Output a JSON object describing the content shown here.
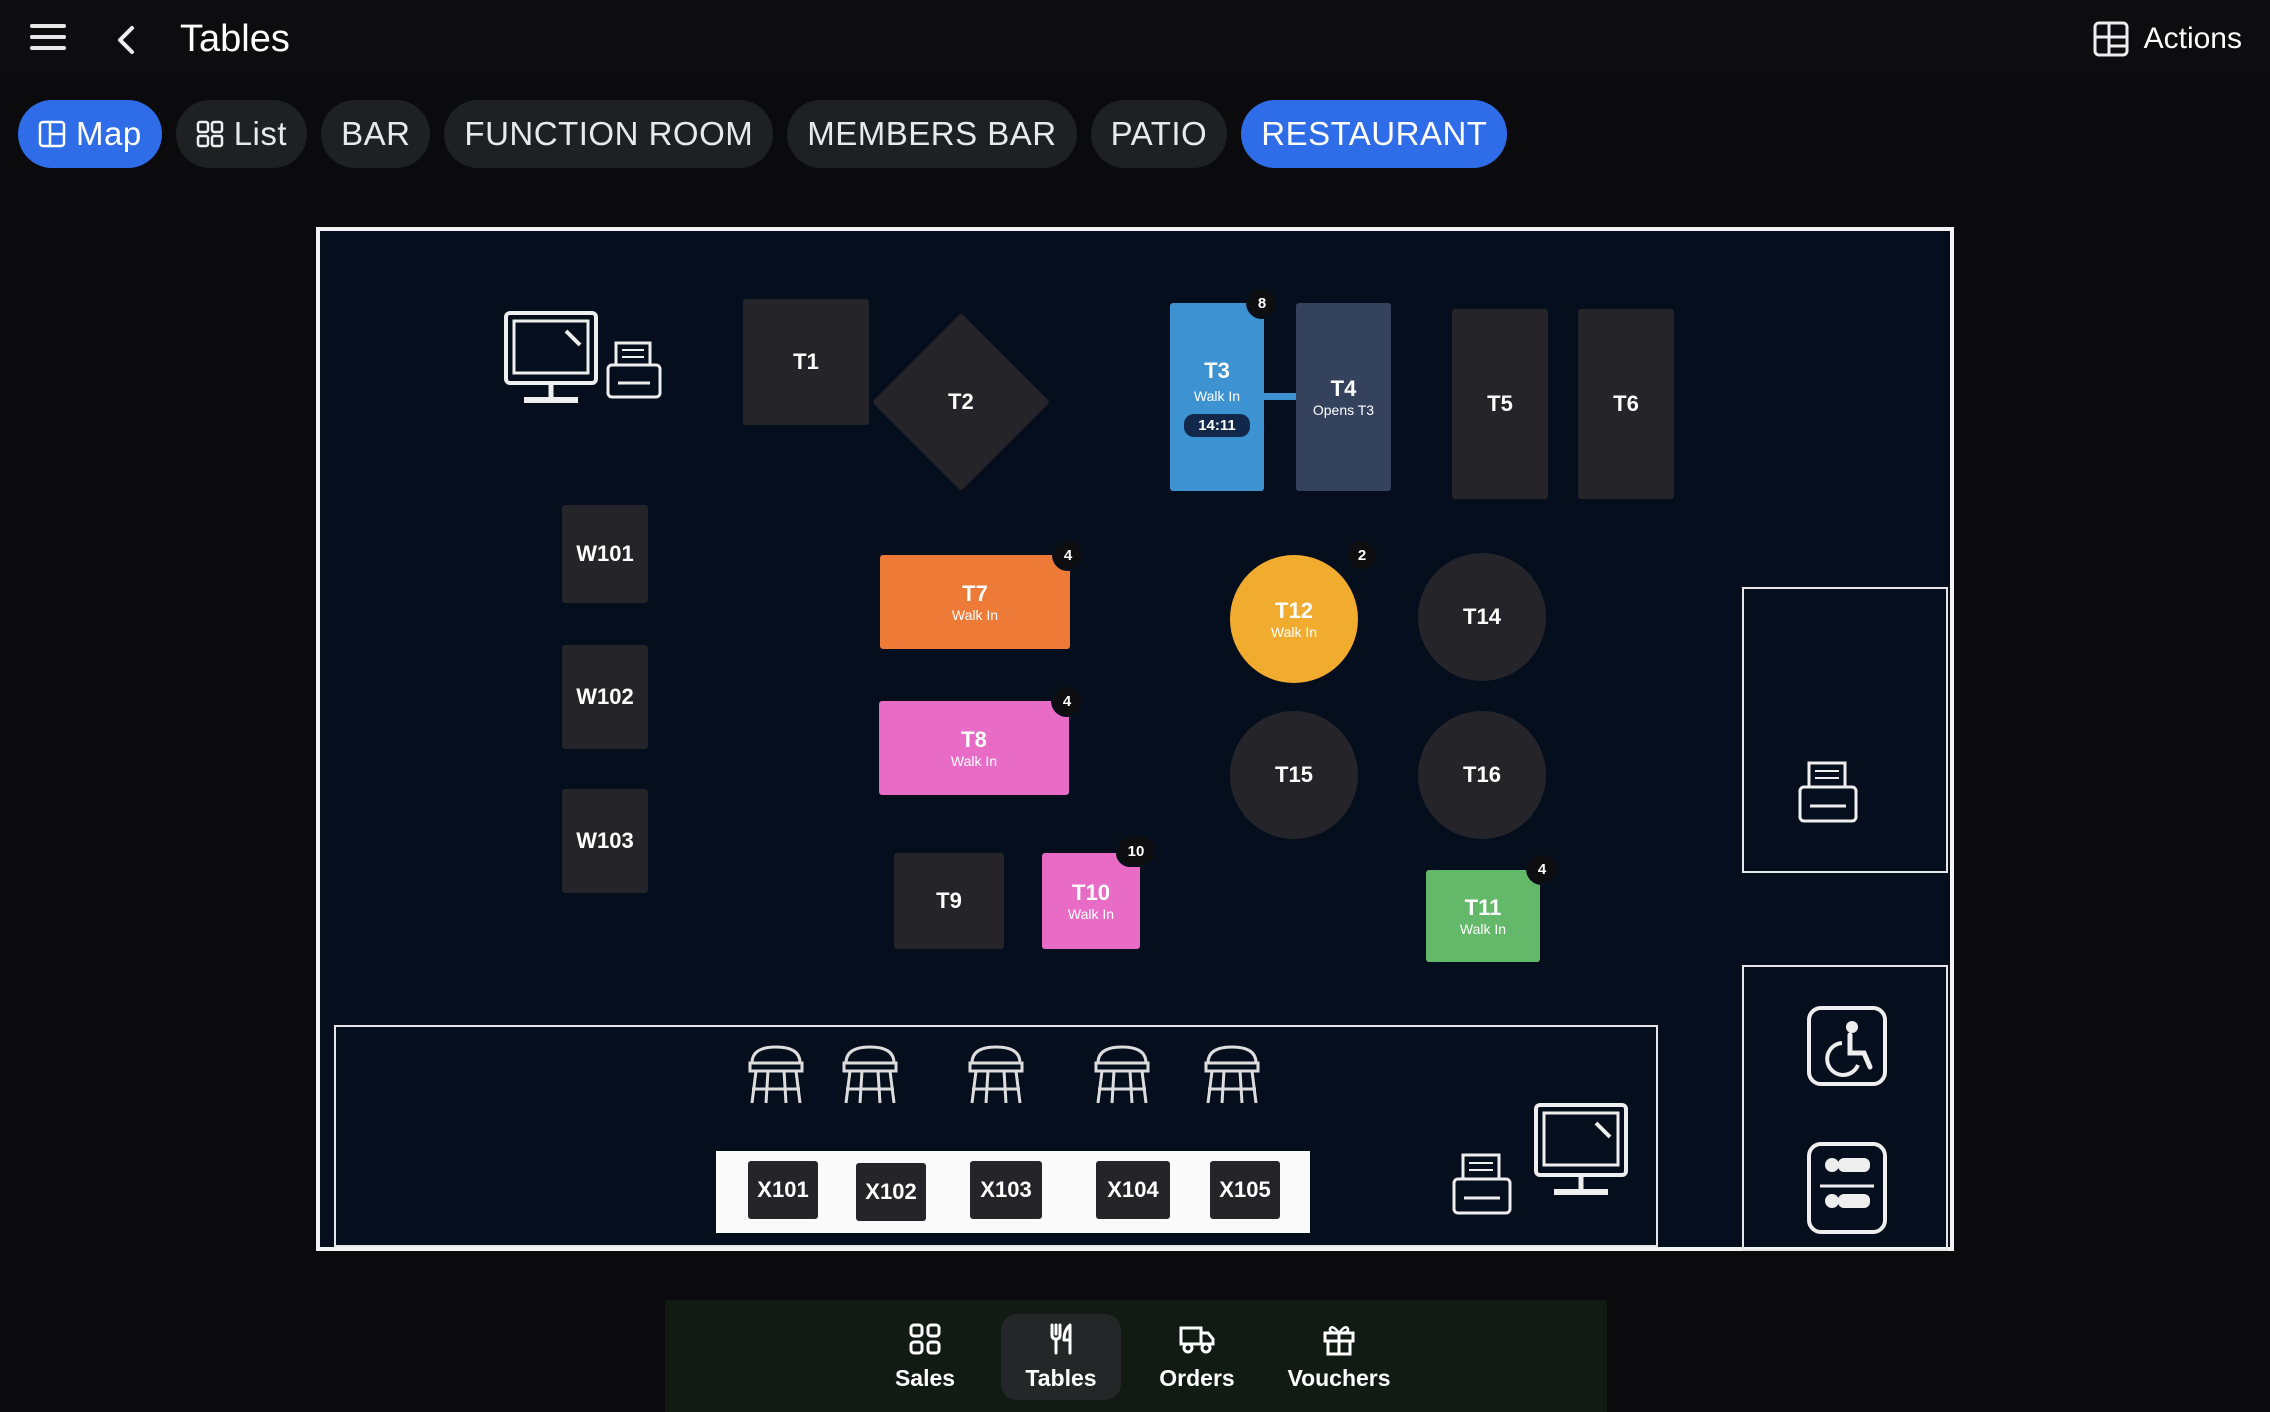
{
  "header": {
    "title": "Tables",
    "actions_label": "Actions"
  },
  "chips": {
    "map": "Map",
    "list": "List",
    "bar": "BAR",
    "function_room": "FUNCTION ROOM",
    "members_bar": "MEMBERS BAR",
    "patio": "PATIO",
    "restaurant": "RESTAURANT"
  },
  "tables": {
    "t1": {
      "name": "T1"
    },
    "t2": {
      "name": "T2"
    },
    "t3": {
      "name": "T3",
      "status": "Walk In",
      "timer": "14:11",
      "covers": "8"
    },
    "t4": {
      "name": "T4",
      "status": "Opens T3"
    },
    "t5": {
      "name": "T5"
    },
    "t6": {
      "name": "T6"
    },
    "t7": {
      "name": "T7",
      "status": "Walk In",
      "covers": "4"
    },
    "t8": {
      "name": "T8",
      "status": "Walk In",
      "covers": "4"
    },
    "t9": {
      "name": "T9"
    },
    "t10": {
      "name": "T10",
      "status": "Walk In",
      "covers": "10"
    },
    "t11": {
      "name": "T11",
      "status": "Walk In",
      "covers": "4"
    },
    "t12": {
      "name": "T12",
      "status": "Walk In",
      "covers": "2"
    },
    "t14": {
      "name": "T14"
    },
    "t15": {
      "name": "T15"
    },
    "t16": {
      "name": "T16"
    },
    "w101": {
      "name": "W101"
    },
    "w102": {
      "name": "W102"
    },
    "w103": {
      "name": "W103"
    },
    "x101": {
      "name": "X101"
    },
    "x102": {
      "name": "X102"
    },
    "x103": {
      "name": "X103"
    },
    "x104": {
      "name": "X104"
    },
    "x105": {
      "name": "X105"
    }
  },
  "colors": {
    "accent": "#2f6de8",
    "t3": "#3d93d2",
    "t4": "#34425e",
    "t7": "#ee7a37",
    "t8_t10": "#e86cc6",
    "t11": "#64b869",
    "t12": "#f1ab2f"
  },
  "bottom_nav": {
    "sales": "Sales",
    "tables": "Tables",
    "orders": "Orders",
    "vouchers": "Vouchers"
  }
}
